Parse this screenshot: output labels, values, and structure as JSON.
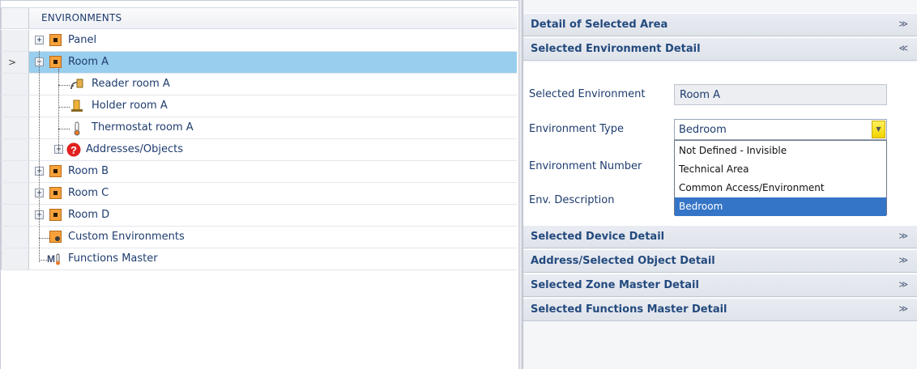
{
  "tree": {
    "column_header": "ENVIRONMENTS",
    "nodes": [
      {
        "label": "Panel",
        "expander": "+"
      },
      {
        "label": "Room A",
        "expander": "−"
      },
      {
        "label": "Reader room A"
      },
      {
        "label": "Holder room A"
      },
      {
        "label": "Thermostat room A"
      },
      {
        "label": "Addresses/Objects",
        "expander": "+"
      },
      {
        "label": "Room B",
        "expander": "+"
      },
      {
        "label": "Room C",
        "expander": "+"
      },
      {
        "label": "Room D",
        "expander": "+"
      },
      {
        "label": "Custom Environments"
      },
      {
        "label": "Functions Master"
      }
    ],
    "selected_marker": ">"
  },
  "panel": {
    "sections": {
      "area": "Detail of Selected Area",
      "environment": "Selected Environment Detail",
      "device": "Selected Device Detail",
      "address": "Address/Selected Object Detail",
      "zone": "Selected Zone Master Detail",
      "functions": "Selected Functions Master Detail"
    },
    "chev_down": "≫",
    "chev_up": "≪",
    "fields": {
      "selected_environment_label": "Selected Environment",
      "selected_environment_value": "Room A",
      "environment_type_label": "Environment Type",
      "environment_type_value": "Bedroom",
      "environment_number_label": "Environment Number",
      "env_description_label": "Env. Description"
    },
    "dropdown_options": [
      "Not Defined - Invisible",
      "Technical Area",
      "Common Access/Environment",
      "Bedroom"
    ],
    "dropdown_button": "▼"
  },
  "colors": {
    "selected_row": "#99ceee",
    "selected_option": "#3575c8",
    "section_text": "#234a7e",
    "env_icon": "#f6a13a"
  }
}
